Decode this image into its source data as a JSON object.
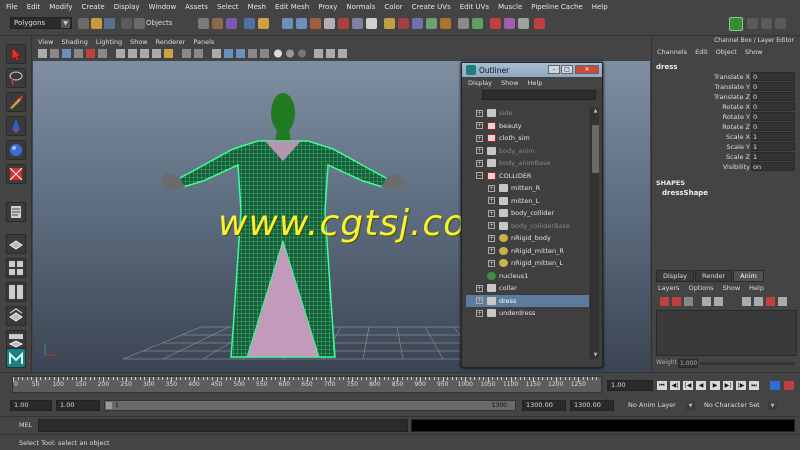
{
  "menubar": [
    "File",
    "Edit",
    "Modify",
    "Create",
    "Display",
    "Window",
    "Assets",
    "Select",
    "Mesh",
    "Edit Mesh",
    "Proxy",
    "Normals",
    "Color",
    "Create UVs",
    "Edit UVs",
    "Muscle",
    "Pipeline Cache",
    "Help"
  ],
  "statusline": {
    "mode": "Polygons",
    "selection_field": "Objects"
  },
  "panel": {
    "menu": [
      "View",
      "Shading",
      "Lighting",
      "Show",
      "Renderer",
      "Panels"
    ]
  },
  "watermark": "www.cgtsj.com",
  "outliner": {
    "title": "Outliner",
    "menu": [
      "Display",
      "Show",
      "Help"
    ],
    "items": [
      {
        "label": "side",
        "icon": "camera-shape-icon",
        "expand": "+",
        "indent": 0,
        "dim": true
      },
      {
        "label": "beauty",
        "icon": "set-icon",
        "expand": "+",
        "indent": 0
      },
      {
        "label": "cloth_sim",
        "icon": "set-icon",
        "expand": "+",
        "indent": 0
      },
      {
        "label": "body_anim",
        "icon": "mesh-shape-icon",
        "expand": "+",
        "indent": 0,
        "dim": true
      },
      {
        "label": "body_animBase",
        "icon": "mesh-shape-icon",
        "expand": "+",
        "indent": 0,
        "dim": true
      },
      {
        "label": "COLLIDER",
        "icon": "set-icon",
        "expand": "−",
        "indent": 0
      },
      {
        "label": "mitten_R",
        "icon": "mesh-shape-icon",
        "expand": "+",
        "indent": 1
      },
      {
        "label": "mitten_L",
        "icon": "mesh-shape-icon",
        "expand": "+",
        "indent": 1
      },
      {
        "label": "body_collider",
        "icon": "mesh-shape-icon",
        "expand": "+",
        "indent": 1
      },
      {
        "label": "body_colliderBase",
        "icon": "mesh-shape-icon",
        "expand": "+",
        "indent": 1,
        "dim": true
      },
      {
        "label": "nRigid_body",
        "icon": "nrigid-icon",
        "expand": "+",
        "indent": 1
      },
      {
        "label": "nRigid_mitten_R",
        "icon": "nrigid-icon",
        "expand": "+",
        "indent": 1
      },
      {
        "label": "nRigid_mitten_L",
        "icon": "nrigid-icon",
        "expand": "+",
        "indent": 1
      },
      {
        "label": "nucleus1",
        "icon": "nucleus-icon",
        "expand": "",
        "indent": 0
      },
      {
        "label": "collar",
        "icon": "mesh-shape-icon",
        "expand": "+",
        "indent": 0
      },
      {
        "label": "dress",
        "icon": "mesh-shape-icon",
        "expand": "+",
        "indent": 0,
        "selected": true
      },
      {
        "label": "underdress",
        "icon": "mesh-shape-icon",
        "expand": "+",
        "indent": 0
      }
    ]
  },
  "channelbox": {
    "title": "Channel Box / Layer Editor",
    "menu": [
      "Channels",
      "Edit",
      "Object",
      "Show"
    ],
    "object": "dress",
    "attributes": [
      {
        "name": "Translate X",
        "value": "0"
      },
      {
        "name": "Translate Y",
        "value": "0"
      },
      {
        "name": "Translate Z",
        "value": "0"
      },
      {
        "name": "Rotate X",
        "value": "0"
      },
      {
        "name": "Rotate Y",
        "value": "0"
      },
      {
        "name": "Rotate Z",
        "value": "0"
      },
      {
        "name": "Scale X",
        "value": "1"
      },
      {
        "name": "Scale Y",
        "value": "1"
      },
      {
        "name": "Scale Z",
        "value": "1"
      },
      {
        "name": "Visibility",
        "value": "on"
      }
    ],
    "shapes_label": "SHAPES",
    "shape_name": "dressShape",
    "layer_tabs": [
      "Display",
      "Render",
      "Anim"
    ],
    "active_layer_tab": "Anim",
    "layer_menu": [
      "Layers",
      "Options",
      "Show",
      "Help"
    ],
    "weight_label": "Weight",
    "weight_value": "1.000"
  },
  "timeslider": {
    "ticks": [
      "0",
      "50",
      "100",
      "150",
      "200",
      "250",
      "300",
      "350",
      "400",
      "450",
      "500",
      "550",
      "600",
      "650",
      "700",
      "750",
      "800",
      "850",
      "900",
      "950",
      "1000",
      "1050",
      "1100",
      "1150",
      "1200",
      "1250"
    ],
    "current_frame": "1.00"
  },
  "range": {
    "start": "1.00",
    "playback_start": "1.00",
    "bar_start": "1",
    "bar_end": "1300",
    "playback_end": "1300.00",
    "end": "1300.00",
    "anim_layer": "No Anim Layer",
    "character_set": "No Character Set"
  },
  "commandline": {
    "label": "MEL"
  },
  "helpline": "Select Tool: select an object",
  "colors": {
    "viewport_top": "#7f8fa1",
    "viewport_bottom": "#3b4452",
    "cloth_wire": "#3dff9a",
    "dress_fill": "#c49abc",
    "watermark": "#f4f432",
    "selection": "#5b7c9c"
  }
}
